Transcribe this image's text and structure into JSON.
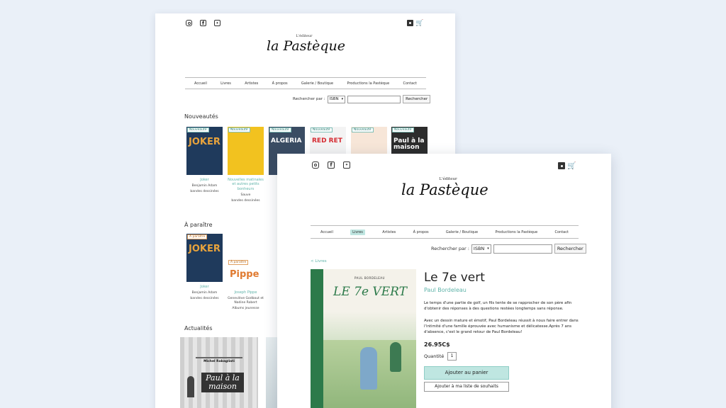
{
  "back": {
    "logo_small": "L'éditeur",
    "logo": "la Pastèque",
    "nav": [
      "Accueil",
      "Livres",
      "Artistes",
      "À propos",
      "Galerie / Boutique",
      "Productions la Pastèque",
      "Contact"
    ],
    "search": {
      "label": "Rechercher par :",
      "select": "ISBN",
      "button": "Rechercher"
    },
    "sections": {
      "new": "Nouveautés",
      "upcoming": "À paraître",
      "news": "Actualités"
    },
    "new_books": [
      {
        "badge": "Nouveauté",
        "title": "Joker",
        "author": "Benjamin Adam",
        "category": "bandes dessinées",
        "cover_text": "JOKER",
        "cover_color": "#1f3a5c",
        "accent": "#e8a33c"
      },
      {
        "badge": "Nouveauté",
        "title": "Nouvelles matinales et autres petits bonheurs",
        "author": "Sauve",
        "category": "bandes dessinées",
        "cover_text": "",
        "cover_color": "#f2c21f",
        "accent": "#ffffff"
      },
      {
        "badge": "Nouveauté",
        "title": "",
        "author": "",
        "category": "",
        "cover_text": "ALGERIA",
        "cover_color": "#3a4c63",
        "accent": "#ffffff"
      },
      {
        "badge": "Nouveauté",
        "title": "",
        "author": "",
        "category": "",
        "cover_text": "RED RET",
        "cover_color": "#f3f3f3",
        "accent": "#d52b32"
      },
      {
        "badge": "Nouveauté",
        "title": "",
        "author": "",
        "category": "",
        "cover_text": "",
        "cover_color": "#f7e6d8",
        "accent": "#c95a4a"
      },
      {
        "badge": "Nouveauté",
        "title": "",
        "author": "",
        "category": "",
        "cover_text": "Paul à la maison",
        "cover_color": "#2c2c2c",
        "accent": "#ffffff"
      }
    ],
    "upcoming_books": [
      {
        "badge": "À paraître",
        "title": "Joker",
        "author": "Benjamin Adam",
        "category": "bandes dessinées",
        "cover_text": "JOKER",
        "cover_color": "#1f3a5c",
        "accent": "#e8a33c"
      },
      {
        "badge": "À paraître",
        "title": "Joseph Pippe",
        "author": "Geneviève Godbout et Nadine Robert",
        "category": "Albums jeunesse",
        "cover_text": "Pippe",
        "cover_color": "#ffffff",
        "accent": "#e07a30"
      }
    ],
    "news_cover": {
      "author": "Michel Rabagliati",
      "title": "Paul à la maison"
    }
  },
  "front": {
    "logo_small": "L'éditeur",
    "logo": "la Pastèque",
    "nav": [
      "Accueil",
      "Livres",
      "Artistes",
      "À propos",
      "Galerie / Boutique",
      "Productions la Pastèque",
      "Contact"
    ],
    "active_nav": "Livres",
    "search": {
      "label": "Rechercher par :",
      "select": "ISBN",
      "button": "Rechercher"
    },
    "back_link": "< Livres",
    "cover": {
      "author": "PAUL BORDELEAU",
      "title": "LE 7e VERT"
    },
    "product": {
      "title": "Le 7e vert",
      "author": "Paul Bordeleau",
      "desc1": "Le temps d'une partie de golf, un fils tente de se rapprocher de son père afin d'obtenir des réponses à des questions restées longtemps sans réponse.",
      "desc2": "Avec un dessin mature et émotif, Paul Bordeleau réussit à nous faire entrer dans l'intimité d'une famille éprouvée avec humanisme et délicatesse.Après 7 ans d'absence, c'est le grand retour de Paul Bordeleau!",
      "price": "26.95C$",
      "qty_label": "Quantité",
      "qty": "1",
      "add_cart": "Ajouter au panier",
      "add_wish": "Ajouter à ma liste de souhaits"
    }
  },
  "colors": {
    "bg": "#eaf0f8",
    "accent": "#5fb3a9",
    "active": "#bfe6e1",
    "cover_green": "#2c7a4a"
  }
}
